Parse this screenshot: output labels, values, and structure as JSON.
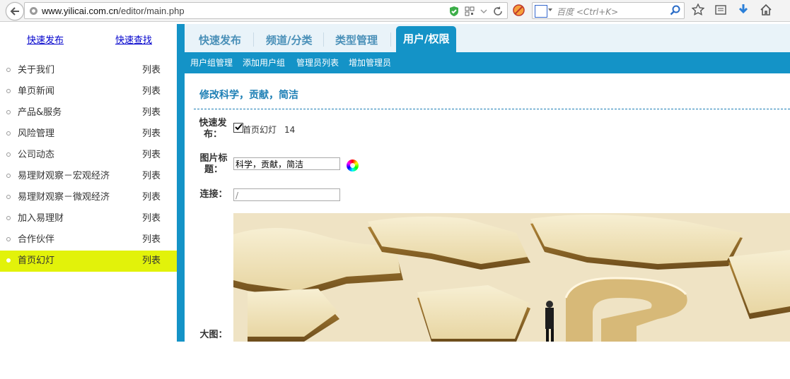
{
  "browser": {
    "url_host": "www.yilicai.com.cn",
    "url_path": "/editor/main.php",
    "search_placeholder": "百度 <Ctrl+K>"
  },
  "sidebar": {
    "quick_publish": "快速发布",
    "quick_find": "快速查找",
    "items": [
      {
        "label": "关于我们",
        "list": "列表"
      },
      {
        "label": "单页新闻",
        "list": "列表"
      },
      {
        "label": "产品&服务",
        "list": "列表"
      },
      {
        "label": "风险管理",
        "list": "列表"
      },
      {
        "label": "公司动态",
        "list": "列表"
      },
      {
        "label": "易理财观察－宏观经济",
        "list": "列表"
      },
      {
        "label": "易理财观察－微观经济",
        "list": "列表"
      },
      {
        "label": "加入易理财",
        "list": "列表"
      },
      {
        "label": "合作伙伴",
        "list": "列表"
      },
      {
        "label": "首页幻灯",
        "list": "列表"
      }
    ],
    "active_index": 9
  },
  "tabs": [
    "快速发布",
    "频道/分类",
    "类型管理",
    "用户/权限"
  ],
  "subnav": [
    "用户组管理",
    "添加用户组",
    "管理员列表",
    "增加管理员"
  ],
  "form": {
    "title": "修改科学，贡献，简洁",
    "quick_publish_label": "快速发布：",
    "quick_publish_option": "首页幻灯",
    "quick_publish_checked": true,
    "quick_publish_num": "14",
    "image_title_label": "图片标题：",
    "image_title_value": "科学，贡献，简洁",
    "link_label": "连接：",
    "link_value": "/",
    "big_image_label": "大图："
  },
  "colors": {
    "accent": "#1493c7",
    "active_menu": "#e2f20a",
    "title": "#1d7fb5"
  }
}
